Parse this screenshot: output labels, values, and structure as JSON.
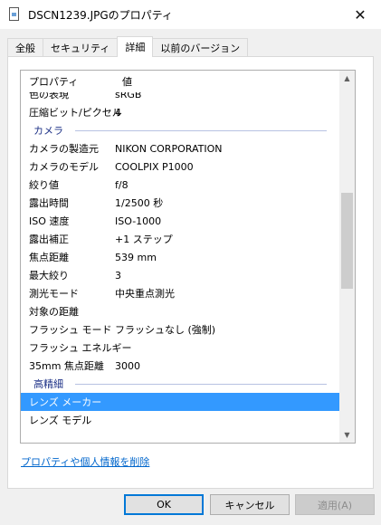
{
  "window": {
    "title": "DSCN1239.JPGのプロパティ",
    "close_glyph": "✕"
  },
  "tabs": [
    {
      "label": "全般",
      "active": false
    },
    {
      "label": "セキュリティ",
      "active": false
    },
    {
      "label": "詳細",
      "active": true
    },
    {
      "label": "以前のバージョン",
      "active": false
    }
  ],
  "list": {
    "header": {
      "property": "プロパティ",
      "value": "値"
    },
    "rows_top": [
      {
        "key": "色の表現",
        "value": "sRGB"
      },
      {
        "key": "圧縮ビット/ピクセル",
        "value": "4"
      }
    ],
    "group_camera": "カメラ",
    "rows_camera": [
      {
        "key": "カメラの製造元",
        "value": "NIKON CORPORATION"
      },
      {
        "key": "カメラのモデル",
        "value": "COOLPIX P1000"
      },
      {
        "key": "絞り値",
        "value": "f/8"
      },
      {
        "key": "露出時間",
        "value": "1/2500 秒"
      },
      {
        "key": "ISO 速度",
        "value": "ISO-1000"
      },
      {
        "key": "露出補正",
        "value": "+1 ステップ"
      },
      {
        "key": "焦点距離",
        "value": "539 mm"
      },
      {
        "key": "最大絞り",
        "value": "3"
      },
      {
        "key": "測光モード",
        "value": "中央重点測光"
      },
      {
        "key": "対象の距離",
        "value": ""
      },
      {
        "key": "フラッシュ モード",
        "value": "フラッシュなし (強制)"
      },
      {
        "key": "フラッシュ エネルギー",
        "value": ""
      },
      {
        "key": "35mm 焦点距離",
        "value": "3000"
      }
    ],
    "group_advanced": "高精細",
    "rows_advanced": [
      {
        "key": "レンズ メーカー",
        "value": "",
        "selected": true
      },
      {
        "key": "レンズ モデル",
        "value": ""
      }
    ],
    "scroll_up_glyph": "▲",
    "scroll_down_glyph": "▼"
  },
  "remove_link": "プロパティや個人情報を削除",
  "buttons": {
    "ok": "OK",
    "cancel": "キャンセル",
    "apply": "適用(A)"
  }
}
